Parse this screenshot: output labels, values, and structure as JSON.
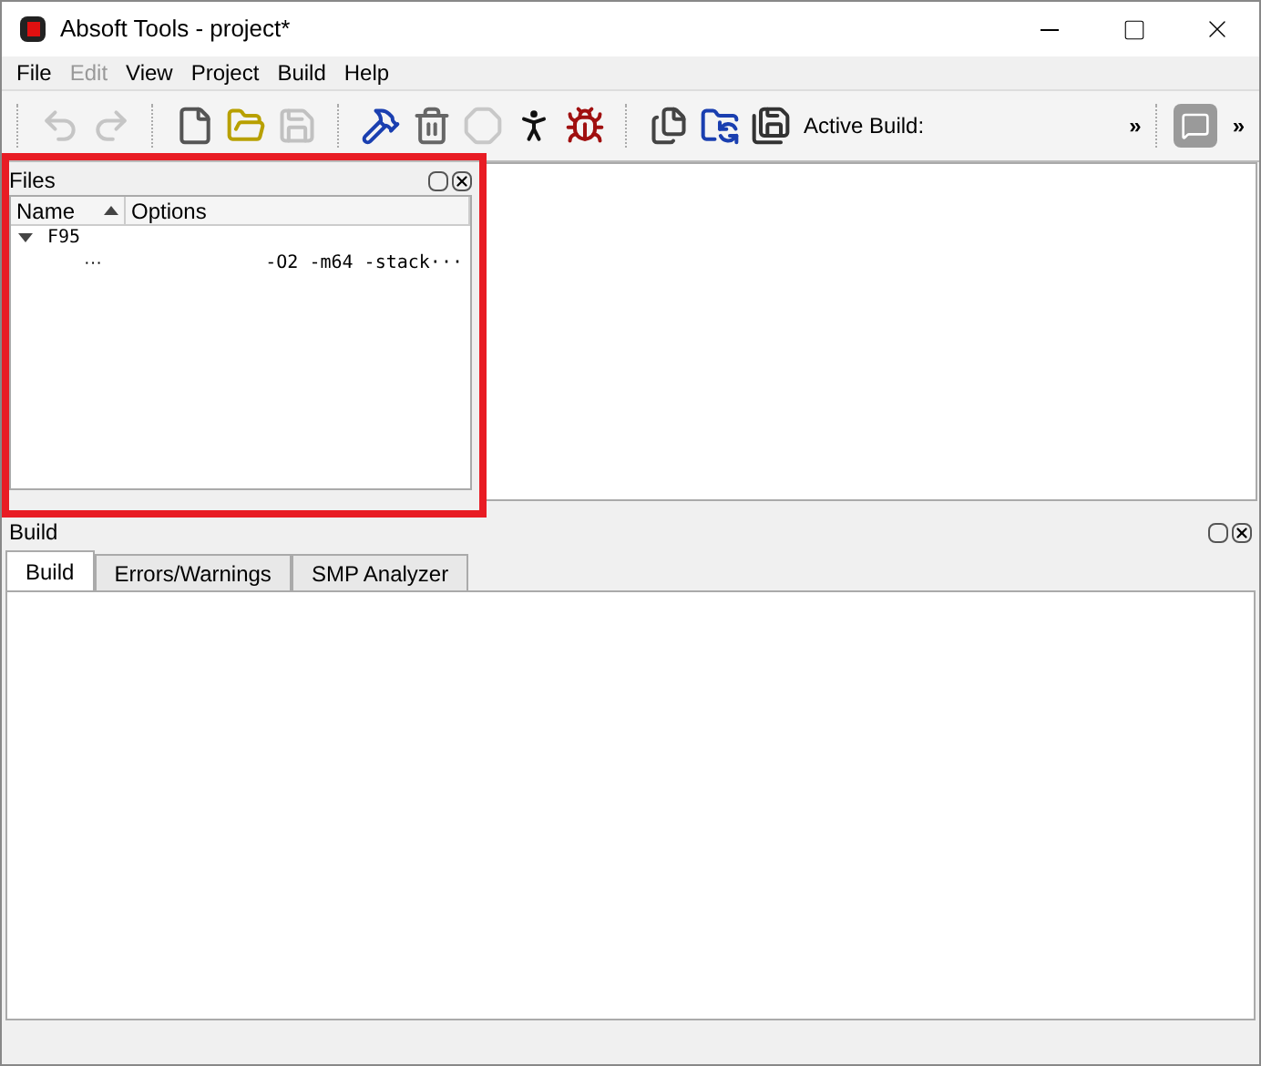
{
  "window": {
    "title": "Absoft Tools - project*"
  },
  "menu": [
    {
      "label": "File",
      "disabled": false
    },
    {
      "label": "Edit",
      "disabled": true
    },
    {
      "label": "View",
      "disabled": false
    },
    {
      "label": "Project",
      "disabled": false
    },
    {
      "label": "Build",
      "disabled": false
    },
    {
      "label": "Help",
      "disabled": false
    }
  ],
  "toolbar": {
    "buttons": [
      {
        "kind": "undo",
        "disabled": true
      },
      {
        "kind": "redo",
        "disabled": true
      },
      {
        "kind": "sep"
      },
      {
        "kind": "new",
        "disabled": false
      },
      {
        "kind": "open",
        "disabled": false
      },
      {
        "kind": "save",
        "disabled": true
      },
      {
        "kind": "sep"
      },
      {
        "kind": "build",
        "disabled": false
      },
      {
        "kind": "clean",
        "disabled": false
      },
      {
        "kind": "stop",
        "disabled": true
      },
      {
        "kind": "run",
        "disabled": false
      },
      {
        "kind": "debug",
        "disabled": false
      },
      {
        "kind": "sep"
      },
      {
        "kind": "copy",
        "disabled": false
      },
      {
        "kind": "reload",
        "disabled": false
      },
      {
        "kind": "saveall",
        "disabled": false
      }
    ],
    "active_build_label": "Active Build:",
    "overflow": "»",
    "overflow_2": "»"
  },
  "files_panel": {
    "title": "Files",
    "columns": [
      {
        "label": "Name",
        "sorted": true
      },
      {
        "label": "Options",
        "sorted": false
      }
    ],
    "tree": [
      {
        "name": "F95",
        "expanded": true,
        "children": [
          {
            "name": "···",
            "options": "-O2 -m64 -stack···"
          }
        ]
      }
    ]
  },
  "build_panel": {
    "title": "Build",
    "tabs": [
      {
        "label": "Build",
        "selected": true
      },
      {
        "label": "Errors/Warnings",
        "selected": false
      },
      {
        "label": "SMP Analyzer",
        "selected": false
      }
    ]
  }
}
